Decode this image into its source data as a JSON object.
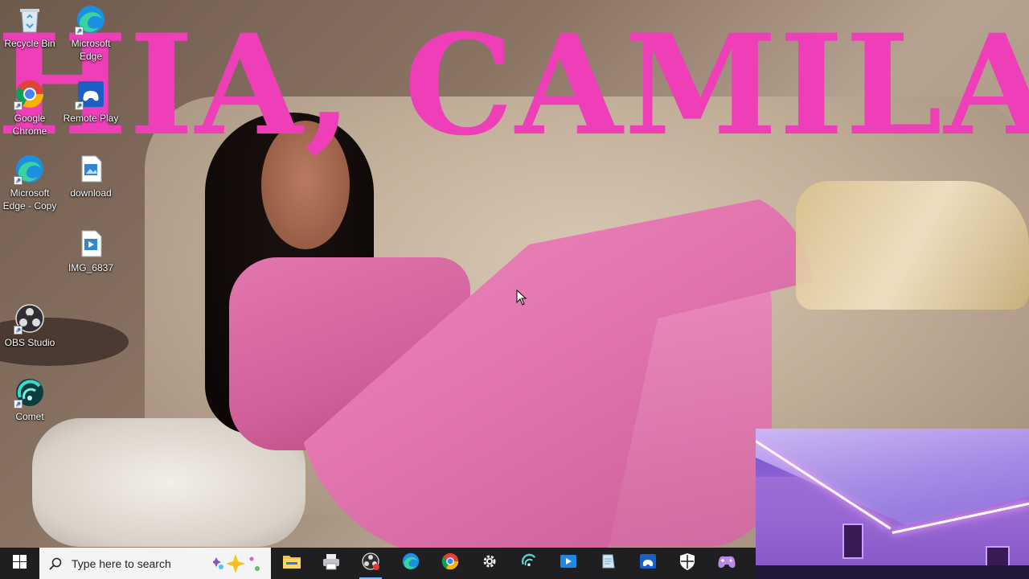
{
  "wallpaper": {
    "banner_text": "HIA, CAMILA"
  },
  "desktop_icons": [
    {
      "label": "Recycle Bin",
      "icon": "recycle-bin-icon"
    },
    {
      "label": "Microsoft Edge",
      "icon": "edge-icon"
    },
    {
      "label": "Google Chrome",
      "icon": "chrome-icon"
    },
    {
      "label": "Remote Play",
      "icon": "remote-play-icon"
    },
    {
      "label": "Microsoft Edge - Copy",
      "icon": "edge-icon"
    },
    {
      "label": "download",
      "icon": "image-file-icon"
    },
    {
      "label": "IMG_6837",
      "icon": "image-file-icon"
    },
    {
      "label": "OBS Studio",
      "icon": "obs-icon"
    },
    {
      "label": "Comet",
      "icon": "comet-icon"
    }
  ],
  "taskbar": {
    "search_placeholder": "Type here to search",
    "buttons": [
      "file-explorer-icon",
      "printer-icon",
      "obs-icon",
      "edge-icon",
      "chrome-icon",
      "settings-icon",
      "comet-icon",
      "media-player-icon",
      "notepad-icon",
      "remote-play-icon",
      "security-icon",
      "game-controller-icon"
    ]
  },
  "colors": {
    "banner": "#ee3fb9",
    "taskbar_bg": "#1f1f21",
    "search_bg": "#f4f4f4"
  }
}
